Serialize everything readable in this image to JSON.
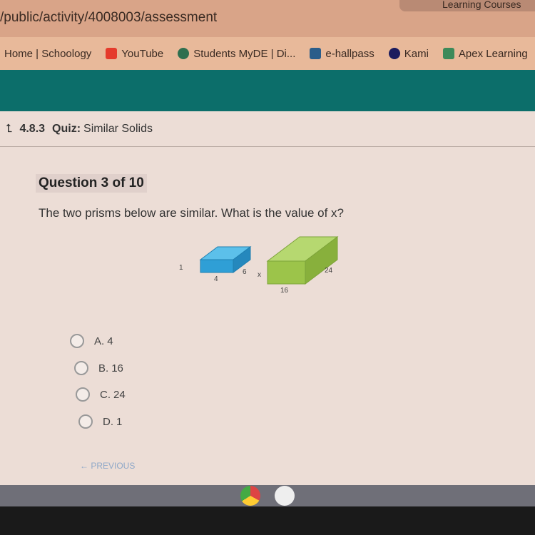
{
  "browser": {
    "address": "/public/activity/4008003/assessment",
    "top_tab": "Learning Courses",
    "bookmarks": [
      {
        "label": "Home | Schoology",
        "color": ""
      },
      {
        "label": "YouTube",
        "color": "#e53b2c"
      },
      {
        "label": "Students MyDE | Di...",
        "color": "#2f6f4f"
      },
      {
        "label": "e-hallpass",
        "color": "#2a5d8a"
      },
      {
        "label": "Kami",
        "color": "#1b1b5e"
      },
      {
        "label": "Apex Learning",
        "color": "#3c8a5a"
      }
    ]
  },
  "quiz": {
    "number": "4.8.3",
    "type": "Quiz:",
    "title": "Similar Solids"
  },
  "question": {
    "header": "Question 3 of 10",
    "text": "The two prisms below are similar. What is the value of x?",
    "figure": {
      "small": {
        "height": "1",
        "width": "4",
        "depth": "6",
        "color": "#2f9fd6"
      },
      "large": {
        "height": "x",
        "width": "16",
        "depth": "24",
        "color": "#9cc44a"
      }
    },
    "options": [
      {
        "letter": "A.",
        "value": "4"
      },
      {
        "letter": "B.",
        "value": "16"
      },
      {
        "letter": "C.",
        "value": "24"
      },
      {
        "letter": "D.",
        "value": "1"
      }
    ]
  },
  "nav": {
    "previous": "← PREVIOUS"
  }
}
